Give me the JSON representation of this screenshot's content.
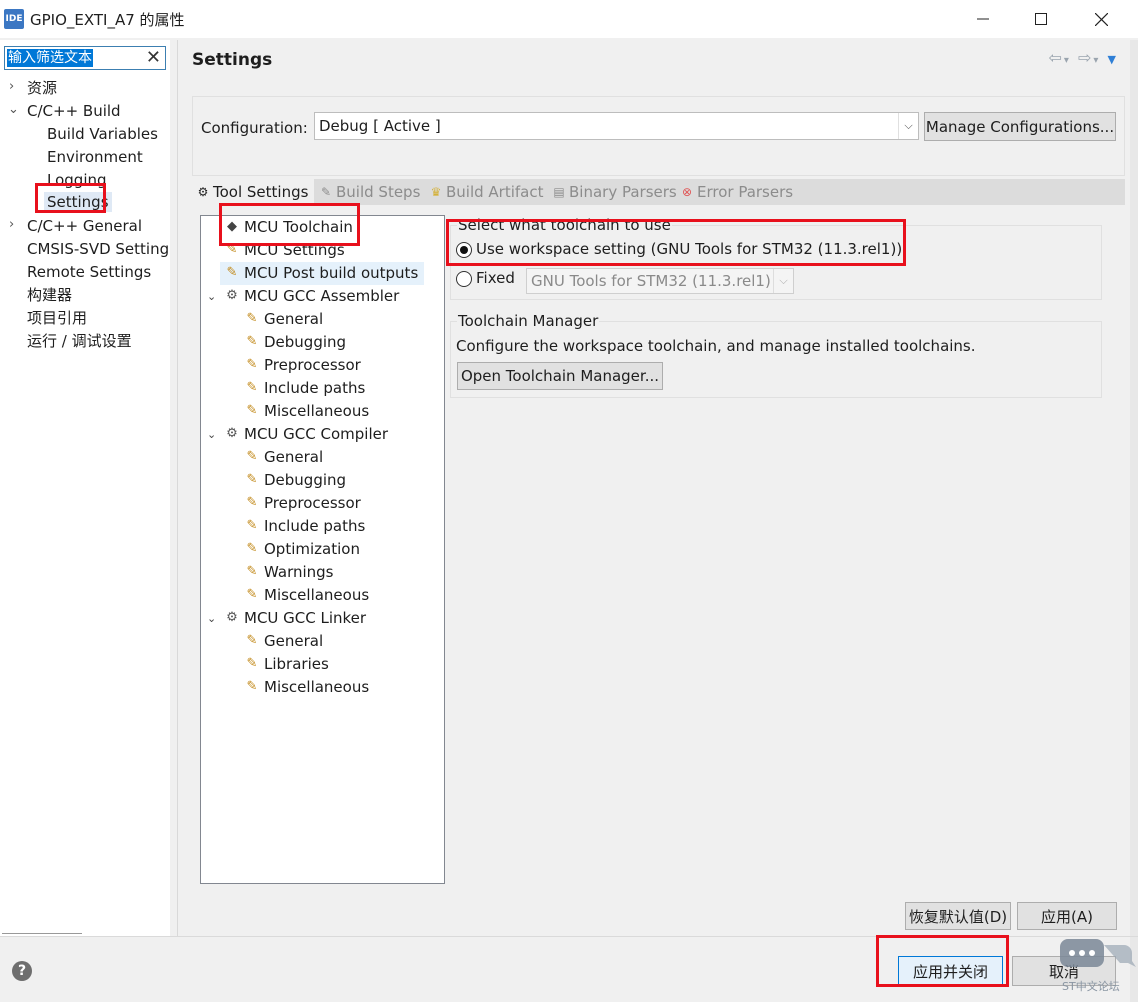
{
  "window": {
    "app_icon": "IDE",
    "title": "GPIO_EXTI_A7 的属性"
  },
  "filter": {
    "text": "输入筛选文本"
  },
  "nav": {
    "resources": "资源",
    "cpp_build": "C/C++ Build",
    "build_variables": "Build Variables",
    "environment": "Environment",
    "logging": "Logging",
    "settings": "Settings",
    "cpp_general": "C/C++ General",
    "cmsis_svd": "CMSIS-SVD Setting",
    "remote_settings": "Remote Settings",
    "builders": "构建器",
    "project_refs": "项目引用",
    "run_debug": "运行 / 调试设置"
  },
  "main": {
    "title": "Settings",
    "configuration_label": "Configuration:",
    "configuration_value": "Debug  [ Active ]",
    "manage_button": "Manage Configurations..."
  },
  "tabs": [
    "Tool Settings",
    "Build Steps",
    "Build Artifact",
    "Binary Parsers",
    "Error Parsers"
  ],
  "tree": {
    "mcu_toolchain": "MCU Toolchain",
    "mcu_settings": "MCU Settings",
    "mcu_post_build": "MCU Post build outputs",
    "assembler": {
      "label": "MCU GCC Assembler",
      "children": [
        "General",
        "Debugging",
        "Preprocessor",
        "Include paths",
        "Miscellaneous"
      ]
    },
    "compiler": {
      "label": "MCU GCC Compiler",
      "children": [
        "General",
        "Debugging",
        "Preprocessor",
        "Include paths",
        "Optimization",
        "Warnings",
        "Miscellaneous"
      ]
    },
    "linker": {
      "label": "MCU GCC Linker",
      "children": [
        "General",
        "Libraries",
        "Miscellaneous"
      ]
    }
  },
  "toolchain": {
    "select_label": "Select what toolchain to use",
    "workspace_option": "Use workspace setting (GNU Tools for STM32 (11.3.rel1))",
    "fixed_option": "Fixed",
    "fixed_value": "GNU Tools for STM32 (11.3.rel1)",
    "manager_heading": "Toolchain Manager",
    "manager_desc": "Configure the workspace toolchain, and manage installed toolchains.",
    "manager_button": "Open Toolchain Manager..."
  },
  "buttons": {
    "restore_defaults": "恢复默认值(D)",
    "apply": "应用(A)",
    "apply_and_close": "应用并关闭",
    "cancel": "取消"
  },
  "watermark": "ST中文论坛",
  "colors": {
    "highlight_box": "#e8101c",
    "selection": "#0078d7"
  }
}
